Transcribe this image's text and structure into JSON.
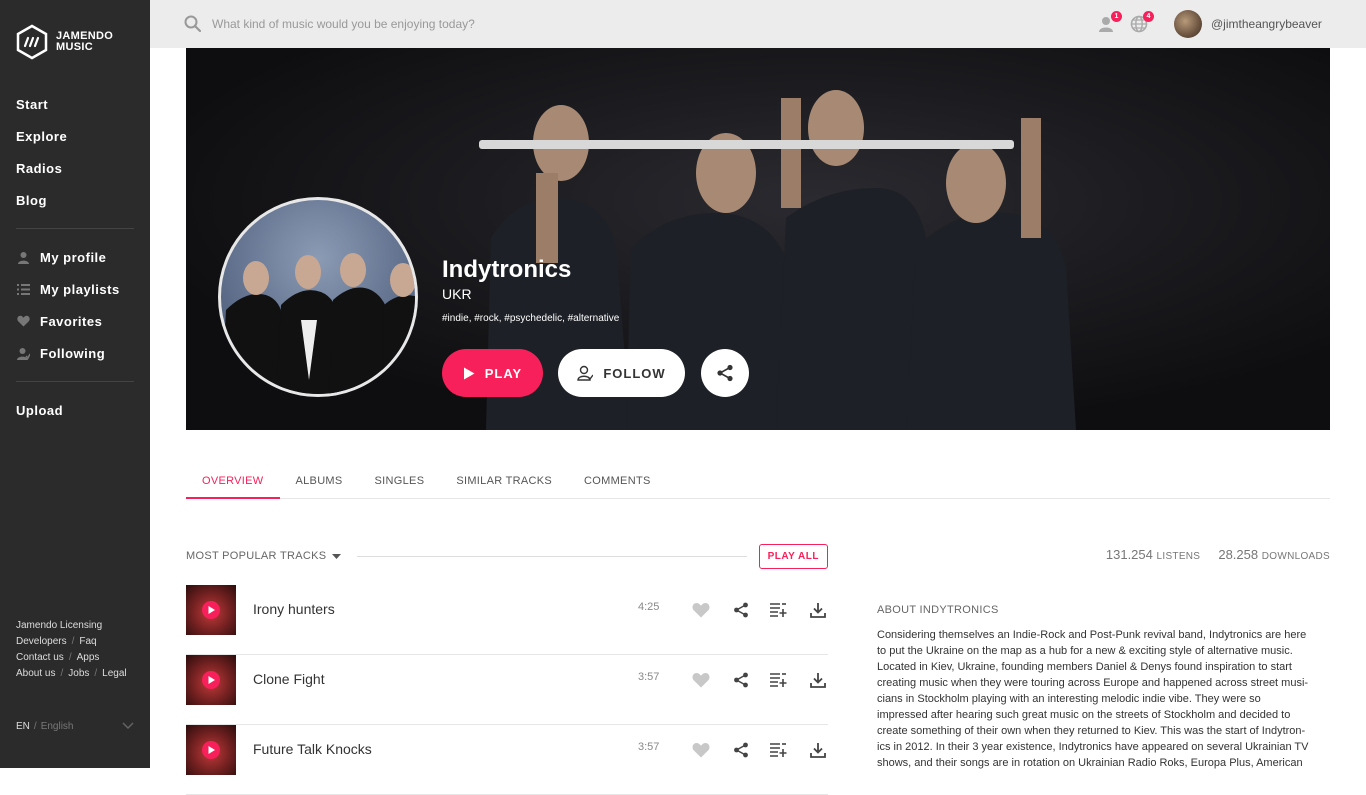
{
  "brand": {
    "line1": "JAMENDO",
    "line2": "MUSIC",
    "accent": "#f7205a"
  },
  "sidebar": {
    "main_nav": [
      {
        "label": "Start"
      },
      {
        "label": "Explore"
      },
      {
        "label": "Radios"
      },
      {
        "label": "Blog"
      }
    ],
    "user_nav": [
      {
        "label": "My profile",
        "icon": "user-icon"
      },
      {
        "label": "My playlists",
        "icon": "playlist-icon"
      },
      {
        "label": "Favorites",
        "icon": "heart-icon"
      },
      {
        "label": "Following",
        "icon": "follow-icon"
      }
    ],
    "upload_label": "Upload",
    "footer_links": [
      [
        "Jamendo Licensing"
      ],
      [
        "Developers",
        "Faq"
      ],
      [
        "Contact us",
        "Apps"
      ],
      [
        "About us",
        "Jobs",
        "Legal"
      ]
    ],
    "language": {
      "code": "EN",
      "name": "English"
    }
  },
  "topbar": {
    "search_placeholder": "What kind of music would you be enjoying today?",
    "friends_badge": "1",
    "globe_badge": "4",
    "username": "@jimtheangrybeaver"
  },
  "artist": {
    "name": "Indytronics",
    "country": "UKR",
    "tags": "#indie, #rock, #psychedelic, #alternative",
    "play_label": "PLAY",
    "follow_label": "FOLLOW"
  },
  "tabs": [
    "OVERVIEW",
    "ALBUMS",
    "SINGLES",
    "SIMILAR TRACKS",
    "COMMENTS"
  ],
  "tracks_section": {
    "title": "MOST POPULAR TRACKS",
    "play_all_label": "PLAY ALL",
    "tracks": [
      {
        "name": "Irony hunters",
        "duration": "4:25"
      },
      {
        "name": "Clone Fight",
        "duration": "3:57"
      },
      {
        "name": "Future Talk Knocks",
        "duration": "3:57"
      }
    ]
  },
  "stats": {
    "listens": "131.254",
    "listens_label": "LISTENS",
    "downloads": "28.258",
    "downloads_label": "DOWNLOADS"
  },
  "about": {
    "title": "ABOUT INDYTRONICS",
    "lines": [
      "Considering themselves an Indie-Rock and Post-Punk revival band, Indytronics are here",
      "to put the Ukraine on the map as a hub for a new & exciting style of alternative music.",
      "Located in Kiev, Ukraine, founding members Daniel & Denys found inspiration to start",
      "creating music when they were touring across Europe and happened across street musi-",
      "cians in Stockholm playing with an interesting melodic indie vibe. They were so",
      "impressed after hearing such great music on the streets of Stockholm and decided to",
      "create something of their own when they returned to Kiev. This was the start of Indytron-",
      "ics in 2012. In their 3 year existence, Indytronics have appeared on several Ukrainian TV",
      "shows, and their songs are in rotation on Ukrainian Radio Roks, Europa Plus, American"
    ]
  }
}
